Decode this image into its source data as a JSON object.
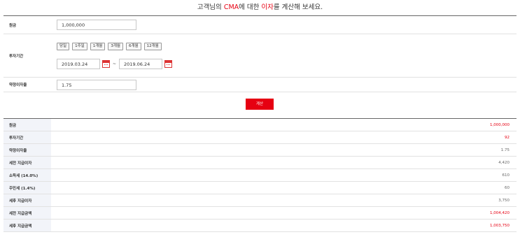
{
  "header": {
    "title_pre": "고객님의 ",
    "title_hl1": "CMA",
    "title_mid": "에 대한 ",
    "title_hl2": "이자",
    "title_post": "를 계산해 보세요."
  },
  "form": {
    "principal_label": "원금",
    "principal_value": "1,000,000",
    "period_label": "투자기간",
    "period_buttons": [
      "당일",
      "1주일",
      "1개월",
      "3개월",
      "6개월",
      "12개월"
    ],
    "start_date": "2019.03.24",
    "date_sep": "~",
    "end_date": "2019.06.24",
    "rate_label": "약정이자율",
    "rate_value": "1.75"
  },
  "calc_button": "계산",
  "results": [
    {
      "label": "원금",
      "value": "1,000,000",
      "color": "#e60012"
    },
    {
      "label": "투자기간",
      "value": "92",
      "color": "#e60012"
    },
    {
      "label": "약정이자율",
      "value": "1.75",
      "color": "#666666"
    },
    {
      "label": "세전 지급이자",
      "value": "4,420",
      "color": "#666666"
    },
    {
      "label": "소득세 (14.0%)",
      "value": "610",
      "color": "#666666"
    },
    {
      "label": "주민세 (1.4%)",
      "value": "60",
      "color": "#666666"
    },
    {
      "label": "세후 지급이자",
      "value": "3,750",
      "color": "#666666"
    },
    {
      "label": "세전 지급금액",
      "value": "1,004,420",
      "color": "#e60012"
    },
    {
      "label": "세후 지급금액",
      "value": "1,003,750",
      "color": "#e60012"
    }
  ],
  "colors": {
    "accent": "#e60012",
    "label_bg": "#f2f4f9"
  }
}
